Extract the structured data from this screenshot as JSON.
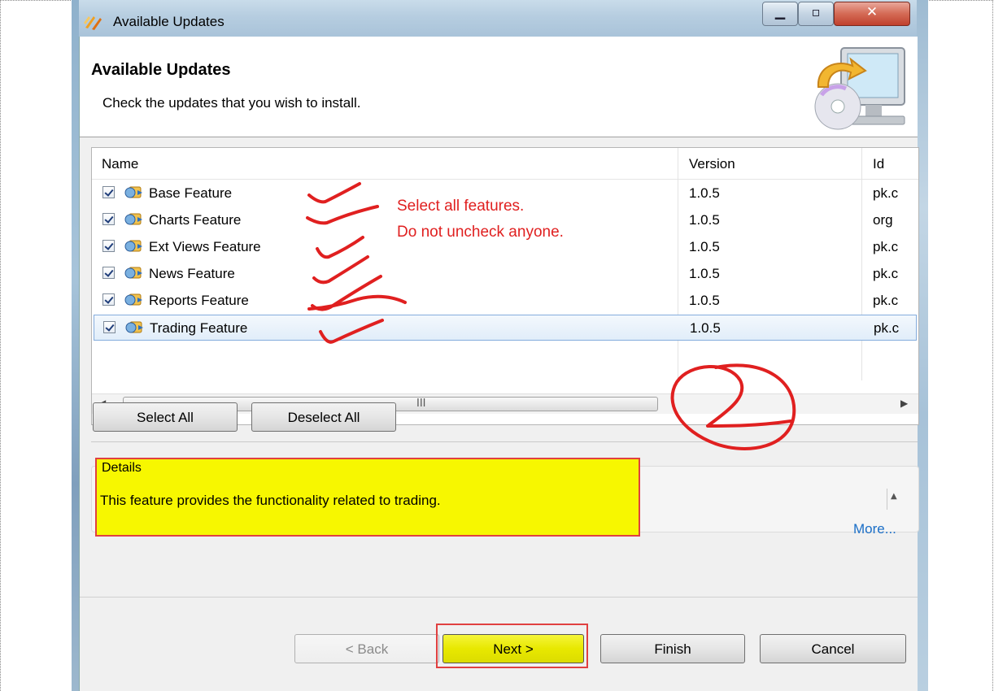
{
  "window": {
    "title": "Available Updates"
  },
  "header": {
    "title": "Available Updates",
    "subtitle": "Check the updates that you wish to install."
  },
  "table": {
    "columns": [
      "Name",
      "Version",
      "Id"
    ],
    "rows": [
      {
        "name": "Base Feature",
        "version": "1.0.5",
        "id": "pk.c",
        "checked": true
      },
      {
        "name": "Charts Feature",
        "version": "1.0.5",
        "id": "org",
        "checked": true
      },
      {
        "name": "Ext Views Feature",
        "version": "1.0.5",
        "id": "pk.c",
        "checked": true
      },
      {
        "name": "News Feature",
        "version": "1.0.5",
        "id": "pk.c",
        "checked": true
      },
      {
        "name": "Reports Feature",
        "version": "1.0.5",
        "id": "pk.c",
        "checked": true
      },
      {
        "name": "Trading Feature",
        "version": "1.0.5",
        "id": "pk.c",
        "checked": true,
        "selected": true
      }
    ],
    "scroll_grip": "III"
  },
  "selection_buttons": {
    "select_all": "Select All",
    "deselect_all": "Deselect All"
  },
  "details": {
    "label": "Details",
    "text": "This feature provides the functionality related to trading.",
    "more_link": "More..."
  },
  "footer": {
    "back": "< Back",
    "next": "Next >",
    "finish": "Finish",
    "cancel": "Cancel"
  },
  "annotations": {
    "line1": "Select all features.",
    "line2": "Do not uncheck anyone.",
    "color": "#e02020",
    "highlight_color": "#f7f700"
  },
  "icons": {
    "app": "update-wizard-icon",
    "feature": "feature-plugin-icon",
    "header": "computer-cd-icon"
  }
}
